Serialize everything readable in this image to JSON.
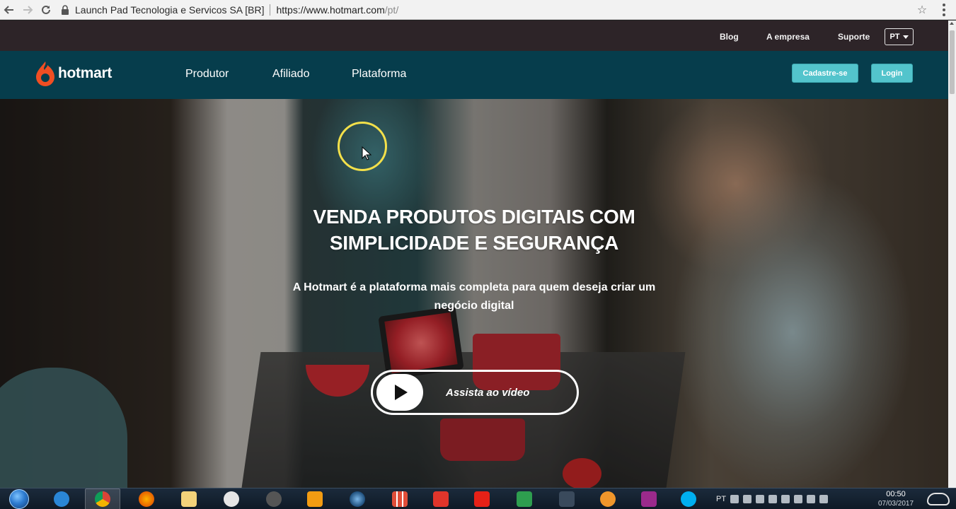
{
  "browser": {
    "security_label": "Launch Pad Tecnologia e Servicos SA [BR]",
    "url_host": "https://www.hotmart.com",
    "url_path": "/pt/",
    "icons": [
      "back-arrow-icon",
      "forward-arrow-icon",
      "reload-icon",
      "lock-icon",
      "star-icon",
      "menu-dots-icon"
    ]
  },
  "topbar": {
    "links": [
      "Blog",
      "A empresa",
      "Suporte"
    ],
    "language": "PT"
  },
  "nav": {
    "logo_text": "hotmart",
    "links": [
      "Produtor",
      "Afiliado",
      "Plataforma"
    ],
    "signup_label": "Cadastre-se",
    "login_label": "Login",
    "brand_color": "#f04e23",
    "accent_color": "#53c4cc",
    "nav_bg": "#063d4c"
  },
  "hero": {
    "title": "VENDA PRODUTOS DIGITAIS COM SIMPLICIDADE E SEGURANÇA",
    "subtitle": "A Hotmart é a plataforma mais completa para quem deseja criar um negócio digital",
    "video_label": "Assista ao vídeo"
  },
  "taskbar": {
    "language": "PT",
    "time": "00:50",
    "date": "07/03/2017"
  }
}
